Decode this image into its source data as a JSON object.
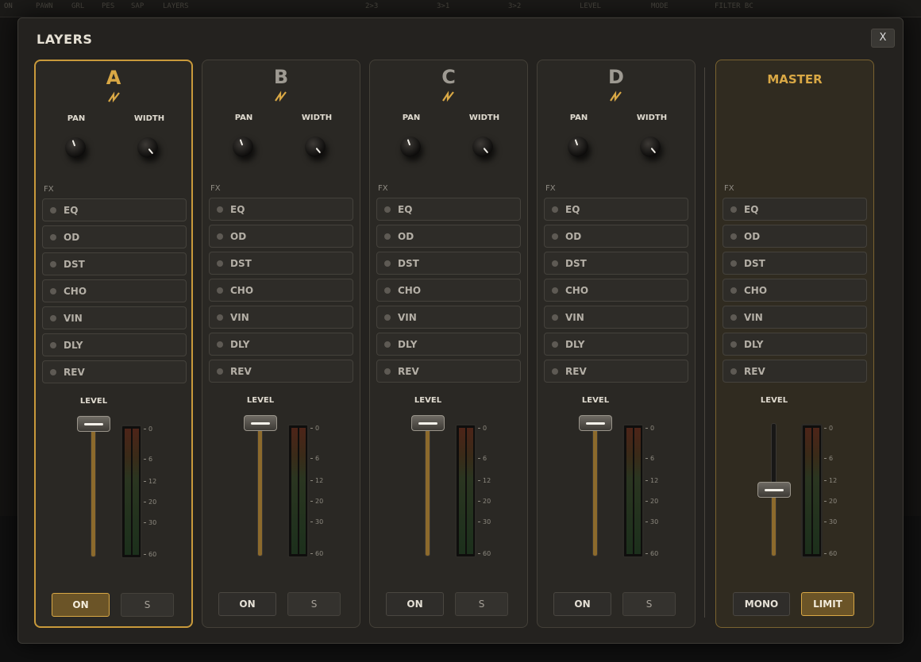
{
  "background": {
    "items": [
      "ON",
      "PAWN",
      "GRL",
      "PES",
      "SAP",
      "LAYERS",
      "2>3",
      "3>1",
      "3>2",
      "LEVEL",
      "MODE",
      "FILTER BC"
    ]
  },
  "modal": {
    "title": "LAYERS",
    "close_label": "X"
  },
  "channels": [
    {
      "name": "A",
      "selected": true,
      "pan_label": "PAN",
      "width_label": "WIDTH",
      "pan_deg": -20,
      "width_deg": 140,
      "fx_label": "FX",
      "fx": [
        "EQ",
        "OD",
        "DST",
        "CHO",
        "VIN",
        "DLY",
        "REV"
      ],
      "level_label": "LEVEL",
      "level": 1.0,
      "meter_ticks": [
        "0",
        "6",
        "12",
        "20",
        "30",
        "60"
      ],
      "on_label": "ON",
      "on_active": true,
      "solo_label": "S"
    },
    {
      "name": "B",
      "selected": false,
      "pan_label": "PAN",
      "width_label": "WIDTH",
      "pan_deg": -20,
      "width_deg": 140,
      "fx_label": "FX",
      "fx": [
        "EQ",
        "OD",
        "DST",
        "CHO",
        "VIN",
        "DLY",
        "REV"
      ],
      "level_label": "LEVEL",
      "level": 1.0,
      "meter_ticks": [
        "0",
        "6",
        "12",
        "20",
        "30",
        "60"
      ],
      "on_label": "ON",
      "on_active": false,
      "solo_label": "S"
    },
    {
      "name": "C",
      "selected": false,
      "pan_label": "PAN",
      "width_label": "WIDTH",
      "pan_deg": -20,
      "width_deg": 140,
      "fx_label": "FX",
      "fx": [
        "EQ",
        "OD",
        "DST",
        "CHO",
        "VIN",
        "DLY",
        "REV"
      ],
      "level_label": "LEVEL",
      "level": 1.0,
      "meter_ticks": [
        "0",
        "6",
        "12",
        "20",
        "30",
        "60"
      ],
      "on_label": "ON",
      "on_active": false,
      "solo_label": "S"
    },
    {
      "name": "D",
      "selected": false,
      "pan_label": "PAN",
      "width_label": "WIDTH",
      "pan_deg": -20,
      "width_deg": 140,
      "fx_label": "FX",
      "fx": [
        "EQ",
        "OD",
        "DST",
        "CHO",
        "VIN",
        "DLY",
        "REV"
      ],
      "level_label": "LEVEL",
      "level": 1.0,
      "meter_ticks": [
        "0",
        "6",
        "12",
        "20",
        "30",
        "60"
      ],
      "on_label": "ON",
      "on_active": false,
      "solo_label": "S"
    }
  ],
  "master": {
    "title": "MASTER",
    "fx_label": "FX",
    "fx": [
      "EQ",
      "OD",
      "DST",
      "CHO",
      "VIN",
      "DLY",
      "REV"
    ],
    "level_label": "LEVEL",
    "level": 0.5,
    "meter_ticks": [
      "0",
      "6",
      "12",
      "20",
      "30",
      "60"
    ],
    "mono_label": "MONO",
    "limit_label": "LIMIT",
    "limit_active": true
  },
  "colors": {
    "accent": "#d9a845",
    "panel": "#2a2824",
    "fill": "#8c6a2c"
  }
}
